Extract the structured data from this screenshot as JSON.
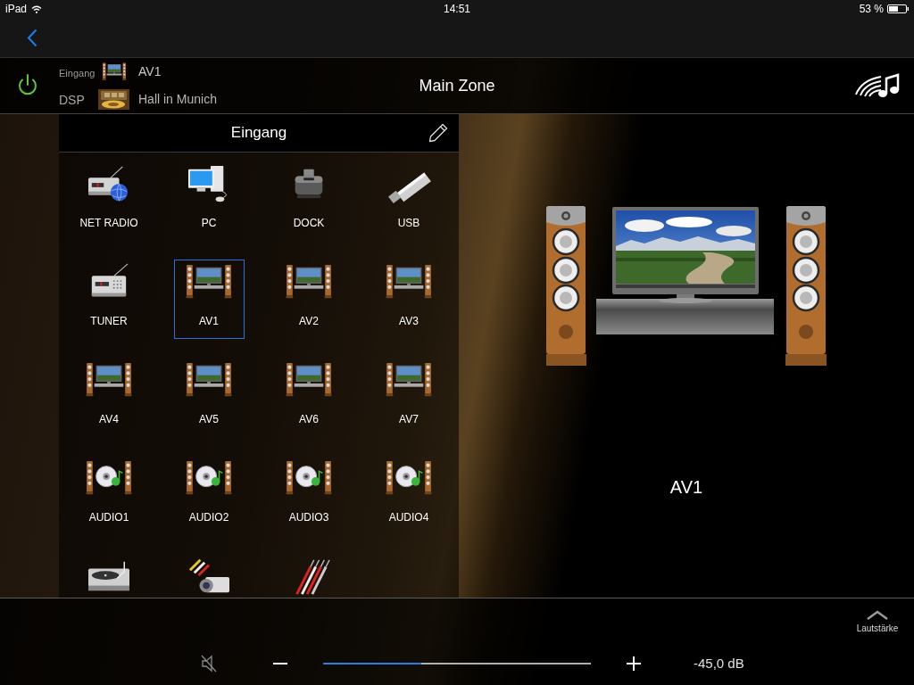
{
  "status_bar": {
    "device": "iPad",
    "time": "14:51",
    "battery": "53 %"
  },
  "header": {
    "power_on": true,
    "input_label": "Eingang",
    "input_value": "AV1",
    "dsp_label": "DSP",
    "dsp_value": "Hall in Munich",
    "zone": "Main Zone"
  },
  "input_panel": {
    "title": "Eingang",
    "items": [
      {
        "label": "NET RADIO",
        "kind": "netradio",
        "selected": false
      },
      {
        "label": "PC",
        "kind": "pc",
        "selected": false
      },
      {
        "label": "DOCK",
        "kind": "dock",
        "selected": false
      },
      {
        "label": "USB",
        "kind": "usb",
        "selected": false
      },
      {
        "label": "TUNER",
        "kind": "tuner",
        "selected": false
      },
      {
        "label": "AV1",
        "kind": "av",
        "selected": true
      },
      {
        "label": "AV2",
        "kind": "av",
        "selected": false
      },
      {
        "label": "AV3",
        "kind": "av",
        "selected": false
      },
      {
        "label": "AV4",
        "kind": "av",
        "selected": false
      },
      {
        "label": "AV5",
        "kind": "av",
        "selected": false
      },
      {
        "label": "AV6",
        "kind": "av",
        "selected": false
      },
      {
        "label": "AV7",
        "kind": "av",
        "selected": false
      },
      {
        "label": "AUDIO1",
        "kind": "audio",
        "selected": false
      },
      {
        "label": "AUDIO2",
        "kind": "audio",
        "selected": false
      },
      {
        "label": "AUDIO3",
        "kind": "audio",
        "selected": false
      },
      {
        "label": "AUDIO4",
        "kind": "audio",
        "selected": false
      },
      {
        "kind": "phono",
        "selected": false
      },
      {
        "kind": "camcorder",
        "selected": false
      },
      {
        "kind": "cables",
        "selected": false
      }
    ]
  },
  "preview": {
    "title": "AV1"
  },
  "volume": {
    "label": "Lautstärke",
    "level": 0.367,
    "reading": "-45,0 dB"
  }
}
